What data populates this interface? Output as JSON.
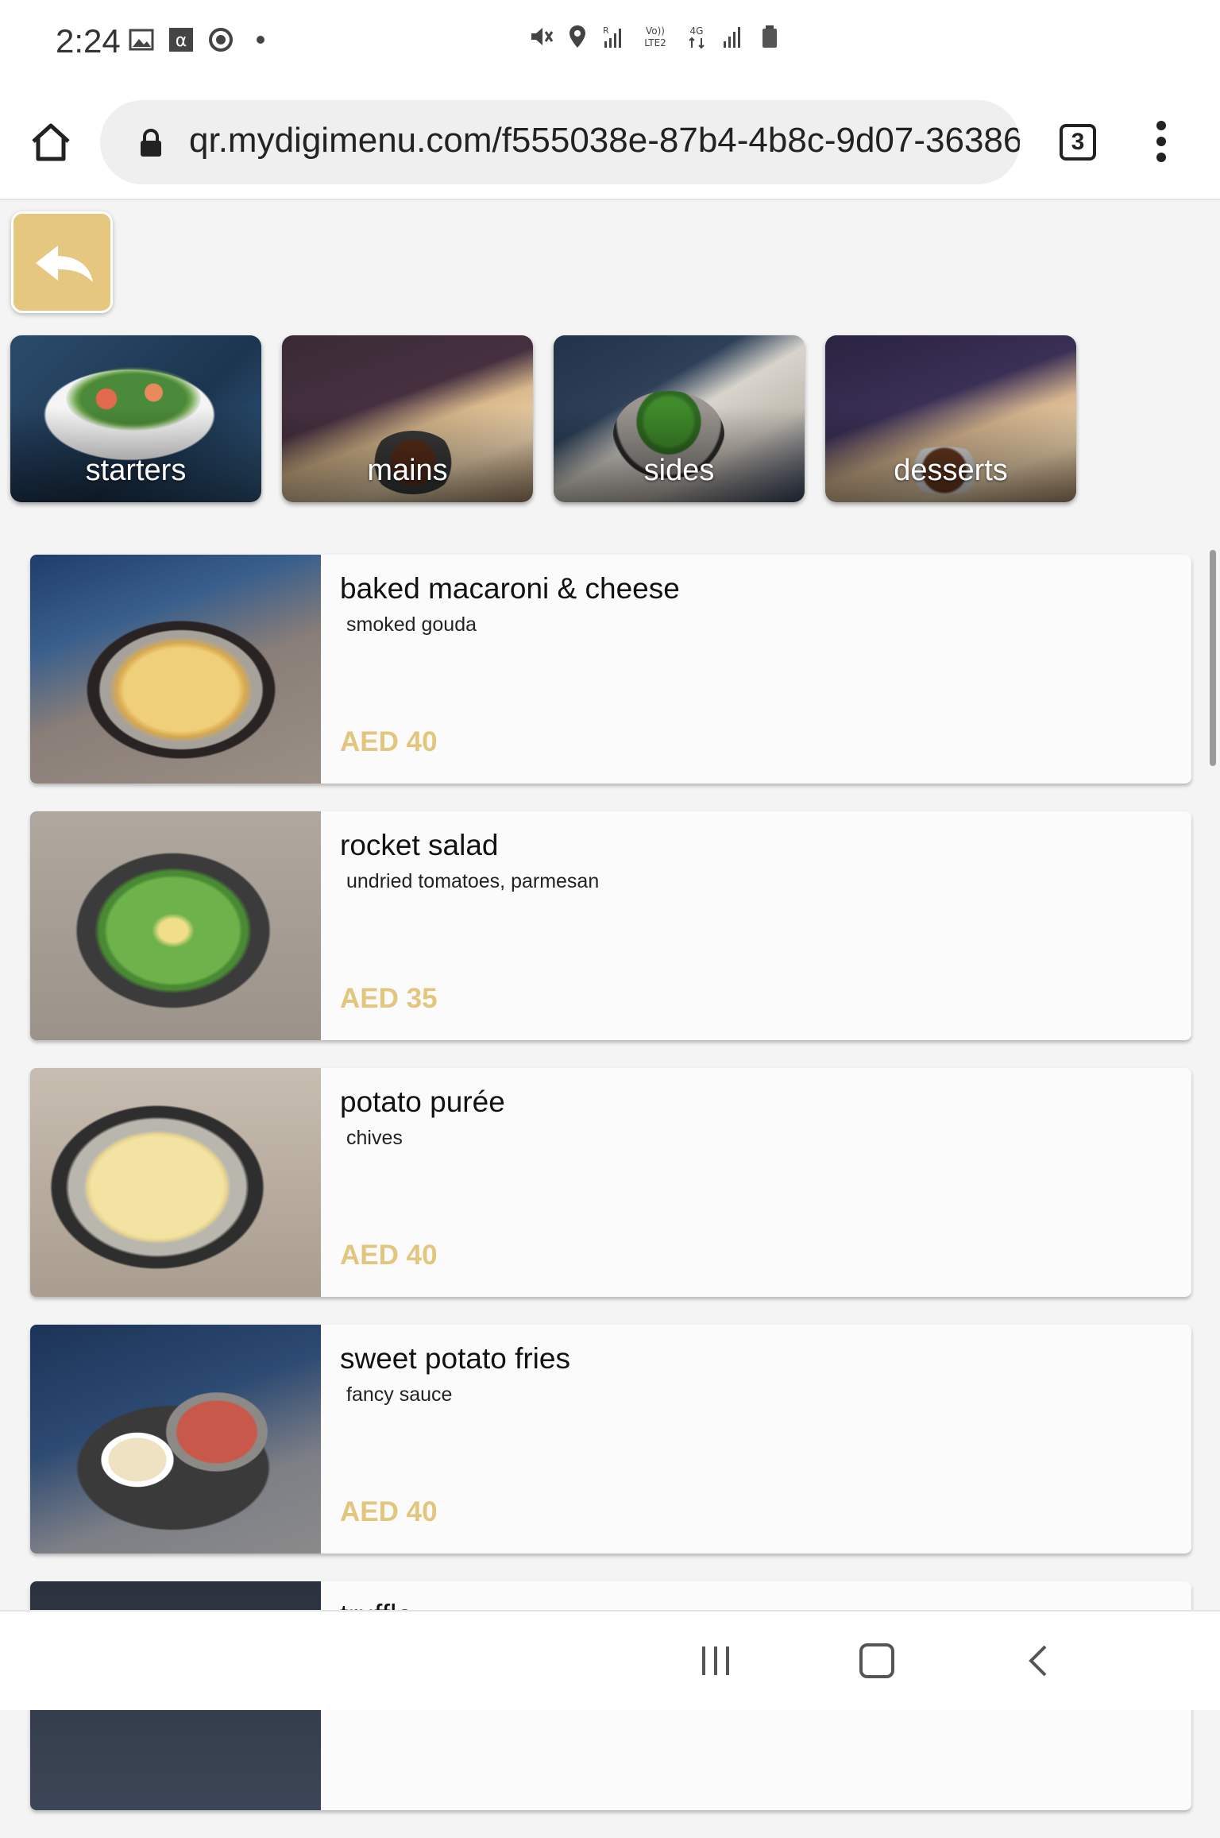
{
  "status_bar": {
    "time": "2:24",
    "left_icons": [
      "image-icon",
      "alpha-icon",
      "play-circle-icon",
      "dot-icon"
    ],
    "right_icons": [
      "mute-vibrate-icon",
      "location-icon",
      "roaming-signal-icon",
      "volte-lte2-icon",
      "4g-data-icon",
      "signal-icon",
      "battery-icon"
    ],
    "roaming_label": "R",
    "volte_label": "Vo)) LTE2",
    "network_label": "4G"
  },
  "browser": {
    "url": "qr.mydigimenu.com/f555038e-87b4-4b8c-9d07-36386",
    "tab_count": "3"
  },
  "categories": [
    {
      "label": "starters"
    },
    {
      "label": "mains"
    },
    {
      "label": "sides"
    },
    {
      "label": "desserts"
    }
  ],
  "menu_items": [
    {
      "title": "baked macaroni & cheese",
      "description": "smoked gouda",
      "price": "AED 40"
    },
    {
      "title": "rocket salad",
      "description": "undried tomatoes, parmesan",
      "price": "AED 35"
    },
    {
      "title": "potato purée",
      "description": "chives",
      "price": "AED 40"
    },
    {
      "title": "sweet potato fries",
      "description": "fancy sauce",
      "price": "AED 40"
    },
    {
      "title": "truffle...",
      "description": "",
      "price": ""
    }
  ],
  "colors": {
    "accent_gold": "#e3c67d",
    "back_button_bg": "#e6c77f"
  }
}
